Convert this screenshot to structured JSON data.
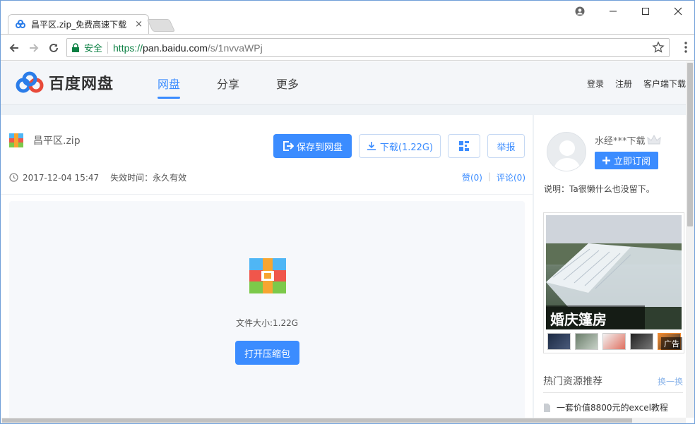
{
  "browser": {
    "tab_title": "昌平区.zip_免费高速下载",
    "tab_close": "×",
    "secure_label": "安全",
    "url_scheme": "https://",
    "url_host": "pan.baidu.com",
    "url_path": "/s/1nvvaWPj"
  },
  "header": {
    "logo_text": "百度网盘",
    "nav": [
      "网盘",
      "分享",
      "更多"
    ],
    "active_nav": "网盘",
    "login": "登录",
    "register": "注册",
    "client_download": "客户端下载"
  },
  "file": {
    "name": "昌平区.zip",
    "save_button": "保存到网盘",
    "download_button": "下载(1.22G)",
    "report_button": "举报",
    "date": "2017-12-04 15:47",
    "expiry": "失效时间：永久有效",
    "like": "赞(0)",
    "comment": "评论(0)",
    "size_text": "文件大小:1.22G",
    "open_button": "打开压缩包"
  },
  "sidebar": {
    "uploader": "水经***下载",
    "subscribe_button": "立即订阅",
    "description": "说明：Ta很懒什么也没留下。",
    "ad_title": "婚庆篷房",
    "ad_tag": "广告",
    "hot_title": "热门资源推荐",
    "hot_more": "换一换",
    "hot_items": [
      "一套价值8800元的excel教程"
    ]
  },
  "colors": {
    "accent": "#3b8cff",
    "secure_green": "#0b8043"
  }
}
